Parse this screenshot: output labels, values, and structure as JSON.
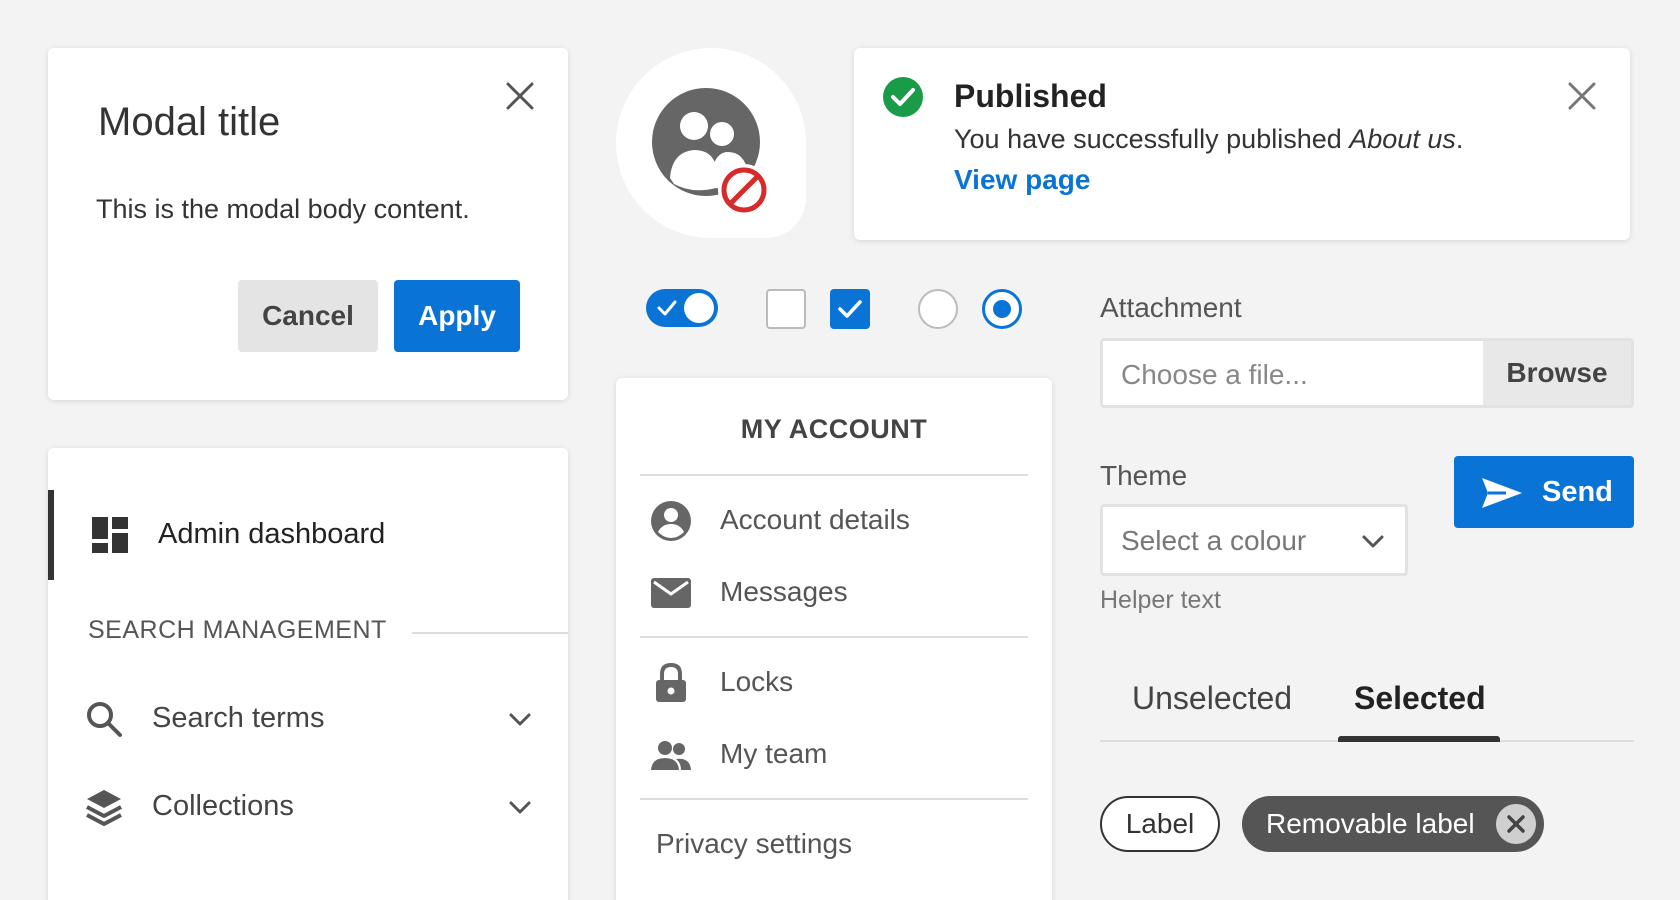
{
  "colors": {
    "primary": "#0a74d6",
    "success": "#1a9b48",
    "danger": "#d62b2b",
    "dark": "#333333"
  },
  "modal": {
    "title": "Modal title",
    "body": "This is the modal body content.",
    "cancel_label": "Cancel",
    "apply_label": "Apply"
  },
  "avatar": {
    "icon": "users-blocked-icon"
  },
  "toast": {
    "title": "Published",
    "message_prefix": "You have successfully published ",
    "message_emphasis": "About us",
    "message_suffix": ".",
    "link": "View page"
  },
  "controls": {
    "toggle_on": true,
    "checkbox_unchecked": false,
    "checkbox_checked": true,
    "radio_unselected": false,
    "radio_selected": true
  },
  "nav": {
    "active_item": "Admin dashboard",
    "section": "SEARCH MANAGEMENT",
    "items": [
      {
        "label": "Search terms",
        "icon": "search-icon"
      },
      {
        "label": "Collections",
        "icon": "layers-icon"
      }
    ]
  },
  "menu": {
    "header": "MY ACCOUNT",
    "items": [
      {
        "label": "Account details",
        "icon": "account-circle-icon"
      },
      {
        "label": "Messages",
        "icon": "mail-icon"
      },
      {
        "label": "Locks",
        "icon": "lock-icon"
      },
      {
        "label": "My team",
        "icon": "team-icon"
      },
      {
        "label": "Privacy settings"
      }
    ]
  },
  "form": {
    "attachment_label": "Attachment",
    "file_placeholder": "Choose a file...",
    "browse_label": "Browse",
    "theme_label": "Theme",
    "select_placeholder": "Select a colour",
    "helper_text": "Helper text",
    "send_label": "Send"
  },
  "tabs": {
    "unselected": "Unselected",
    "selected": "Selected"
  },
  "labels": {
    "label": "Label",
    "removable": "Removable label"
  }
}
